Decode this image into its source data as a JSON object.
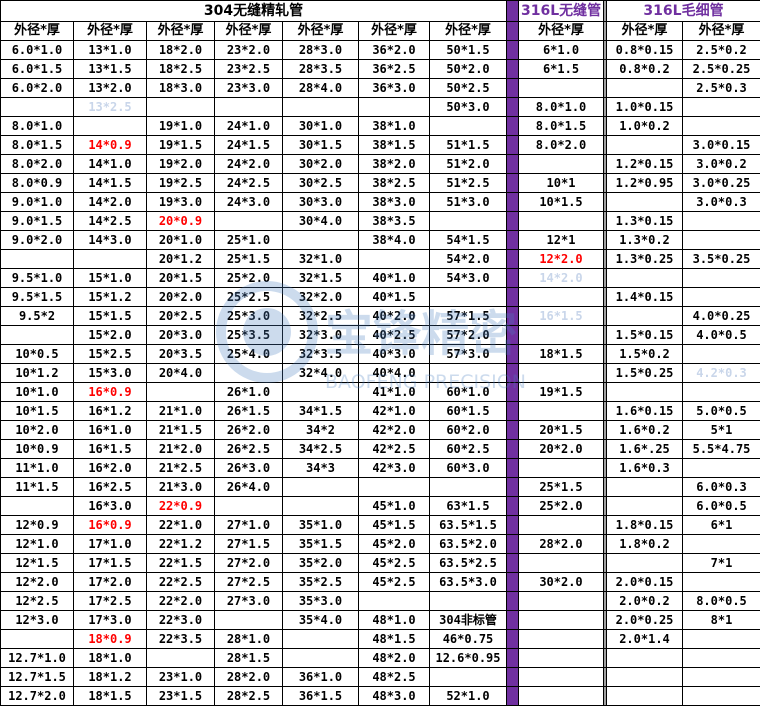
{
  "titles": {
    "t304": "304无缝精轧管",
    "t316": "316L无缝管",
    "t316cap": "316L毛细管"
  },
  "headers": [
    "外径*厚",
    "外径*厚",
    "外径*厚",
    "外径*厚",
    "外径*厚",
    "外径*厚",
    "外径*厚",
    "外径*厚",
    "外径*厚",
    "外径*厚"
  ],
  "colors": {
    "purple": "#7030A0",
    "red": "#ff0000",
    "faint": "#c9d6ea"
  },
  "watermark": {
    "cn": "宝锋精密",
    "en": "BAOFENG PRECISION"
  },
  "rows": [
    [
      "6.0*1.0",
      "13*1.0",
      "18*2.0",
      "23*2.0",
      "28*3.0",
      "36*2.0",
      "50*1.5",
      "6*1.0",
      "0.8*0.15",
      "2.5*0.2"
    ],
    [
      "6.0*1.5",
      "13*1.5",
      "18*2.5",
      "23*2.5",
      "28*3.5",
      "36*2.5",
      "50*2.0",
      "6*1.5",
      "0.8*0.2",
      "2.5*0.25"
    ],
    [
      "6.0*2.0",
      "13*2.0",
      "18*3.0",
      "23*3.0",
      "28*4.0",
      "36*3.0",
      "50*2.5",
      "",
      "",
      "2.5*0.3"
    ],
    [
      "",
      "13*2.5",
      "",
      "",
      "",
      "",
      "50*3.0",
      "8.0*1.0",
      "1.0*0.15",
      ""
    ],
    [
      "8.0*1.0",
      "",
      "19*1.0",
      "24*1.0",
      "30*1.0",
      "38*1.0",
      "",
      "8.0*1.5",
      "1.0*0.2",
      ""
    ],
    [
      "8.0*1.5",
      "14*0.9",
      "19*1.5",
      "24*1.5",
      "30*1.5",
      "38*1.5",
      "51*1.5",
      "8.0*2.0",
      "",
      "3.0*0.15"
    ],
    [
      "8.0*2.0",
      "14*1.0",
      "19*2.0",
      "24*2.0",
      "30*2.0",
      "38*2.0",
      "51*2.0",
      "",
      "1.2*0.15",
      "3.0*0.2"
    ],
    [
      "8.0*0.9",
      "14*1.5",
      "19*2.5",
      "24*2.5",
      "30*2.5",
      "38*2.5",
      "51*2.5",
      "10*1",
      "1.2*0.95",
      "3.0*0.25"
    ],
    [
      "9.0*1.0",
      "14*2.0",
      "19*3.0",
      "24*3.0",
      "30*3.0",
      "38*3.0",
      "51*3.0",
      "10*1.5",
      "",
      "3.0*0.3"
    ],
    [
      "9.0*1.5",
      "14*2.5",
      "20*0.9",
      "",
      "30*4.0",
      "38*3.5",
      "",
      "",
      "1.3*0.15",
      ""
    ],
    [
      "9.0*2.0",
      "14*3.0",
      "20*1.0",
      "25*1.0",
      "",
      "38*4.0",
      "54*1.5",
      "12*1",
      "1.3*0.2",
      ""
    ],
    [
      "",
      "",
      "20*1.2",
      "25*1.5",
      "32*1.0",
      "",
      "54*2.0",
      "12*2.0",
      "1.3*0.25",
      "3.5*0.25"
    ],
    [
      "9.5*1.0",
      "15*1.0",
      "20*1.5",
      "25*2.0",
      "32*1.5",
      "40*1.0",
      "54*3.0",
      "14*2.0",
      "",
      ""
    ],
    [
      "9.5*1.5",
      "15*1.2",
      "20*2.0",
      "25*2.5",
      "32*2.0",
      "40*1.5",
      "",
      "",
      "1.4*0.15",
      ""
    ],
    [
      "9.5*2",
      "15*1.5",
      "20*2.5",
      "25*3.0",
      "32*2.5",
      "40*2.0",
      "57*1.5",
      "16*1.5",
      "",
      "4.0*0.25"
    ],
    [
      "",
      "15*2.0",
      "20*3.0",
      "25*3.5",
      "32*3.0",
      "40*2.5",
      "57*2.0",
      "",
      "1.5*0.15",
      "4.0*0.5"
    ],
    [
      "10*0.5",
      "15*2.5",
      "20*3.5",
      "25*4.0",
      "32*3.5",
      "40*3.0",
      "57*3.0",
      "18*1.5",
      "1.5*0.2",
      ""
    ],
    [
      "10*1.2",
      "15*3.0",
      "20*4.0",
      "",
      "32*4.0",
      "40*4.0",
      "",
      "",
      "1.5*0.25",
      "4.2*0.3"
    ],
    [
      "10*1.0",
      "16*0.9",
      "",
      "26*1.0",
      "",
      "41*1.0",
      "60*1.0",
      "19*1.5",
      "",
      ""
    ],
    [
      "10*1.5",
      "16*1.2",
      "21*1.0",
      "26*1.5",
      "34*1.5",
      "42*1.0",
      "60*1.5",
      "",
      "1.6*0.15",
      "5.0*0.5"
    ],
    [
      "10*2.0",
      "16*1.0",
      "21*1.5",
      "26*2.0",
      "34*2",
      "42*2.0",
      "60*2.0",
      "20*1.5",
      "1.6*0.2",
      "5*1"
    ],
    [
      "10*0.9",
      "16*1.5",
      "21*2.0",
      "26*2.5",
      "34*2.5",
      "42*2.5",
      "60*2.5",
      "20*2.0",
      "1.6*.25",
      "5.5*4.75"
    ],
    [
      "11*1.0",
      "16*2.0",
      "21*2.5",
      "26*3.0",
      "34*3",
      "42*3.0",
      "60*3.0",
      "",
      "1.6*0.3",
      ""
    ],
    [
      "11*1.5",
      "16*2.5",
      "21*3.0",
      "26*4.0",
      "",
      "",
      "",
      "25*1.5",
      "",
      "6.0*0.3"
    ],
    [
      "",
      "16*3.0",
      "22*0.9",
      "",
      "",
      "45*1.0",
      "63*1.5",
      "25*2.0",
      "",
      "6.0*0.5"
    ],
    [
      "12*0.9",
      "16*0.9",
      "22*1.0",
      "27*1.0",
      "35*1.0",
      "45*1.5",
      "63.5*1.5",
      "",
      "1.8*0.15",
      "6*1"
    ],
    [
      "12*1.0",
      "17*1.0",
      "22*1.2",
      "27*1.5",
      "35*1.5",
      "45*2.0",
      "63.5*2.0",
      "28*2.0",
      "1.8*0.2",
      ""
    ],
    [
      "12*1.5",
      "17*1.5",
      "22*1.5",
      "27*2.0",
      "35*2.0",
      "45*2.5",
      "63.5*2.5",
      "",
      "",
      "7*1"
    ],
    [
      "12*2.0",
      "17*2.0",
      "22*2.5",
      "27*2.5",
      "35*2.5",
      "45*2.5",
      "63.5*3.0",
      "30*2.0",
      "2.0*0.15",
      ""
    ],
    [
      "12*2.5",
      "17*2.5",
      "22*2.0",
      "27*3.0",
      "35*3.0",
      "",
      "",
      "",
      "2.0*0.2",
      "8.0*0.5"
    ],
    [
      "12*3.0",
      "17*3.0",
      "22*3.0",
      "",
      "35*4.0",
      "48*1.0",
      "304非标管",
      "",
      "2.0*0.25",
      "8*1"
    ],
    [
      "",
      "18*0.9",
      "22*3.5",
      "28*1.0",
      "",
      "48*1.5",
      "46*0.75",
      "",
      "2.0*1.4",
      ""
    ],
    [
      "12.7*1.0",
      "18*1.0",
      "",
      "28*1.5",
      "",
      "48*2.0",
      "12.6*0.95",
      "",
      "",
      ""
    ],
    [
      "12.7*1.5",
      "18*1.2",
      "23*1.0",
      "28*2.0",
      "36*1.0",
      "48*2.5",
      "",
      "",
      "",
      ""
    ],
    [
      "12.7*2.0",
      "18*1.5",
      "23*1.5",
      "28*2.5",
      "36*1.5",
      "48*3.0",
      "52*1.0",
      "",
      "",
      ""
    ]
  ],
  "styles": {
    "red": [
      "5-1",
      "9-2",
      "11-7",
      "18-1",
      "24-2",
      "25-1",
      "31-1"
    ],
    "faint": [
      "3-1",
      "12-7",
      "14-7",
      "17-9"
    ]
  }
}
